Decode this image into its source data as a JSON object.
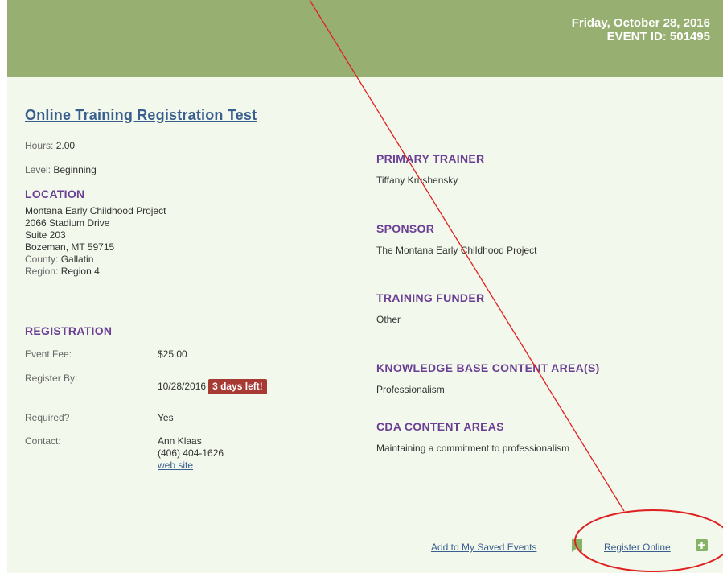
{
  "header": {
    "date": "Friday, October 28, 2016",
    "event_id": "EVENT ID: 501495"
  },
  "event": {
    "title": "Online Training Registration Test",
    "hours_label": "Hours:",
    "hours_value": "2.00",
    "level_label": "Level:",
    "level_value": "Beginning"
  },
  "location": {
    "heading": "LOCATION",
    "lines": [
      "Montana Early Childhood Project",
      "2066 Stadium Drive",
      "Suite 203",
      "Bozeman, MT 59715"
    ],
    "county_label": "County:",
    "county_value": "Gallatin",
    "region_label": "Region:",
    "region_value": "Region 4"
  },
  "registration": {
    "heading": "REGISTRATION",
    "fee_label": "Event Fee:",
    "fee_value": "$25.00",
    "register_by_label": "Register By:",
    "register_by_value": "10/28/2016",
    "days_left_badge": "3 days left!",
    "required_label": "Required?",
    "required_value": "Yes",
    "contact_label": "Contact:",
    "contact_name": "Ann Klaas",
    "contact_phone": "(406) 404-1626",
    "contact_link": "web site"
  },
  "details": {
    "primary_trainer_heading": "PRIMARY TRAINER",
    "primary_trainer_value": "Tiffany Krushensky",
    "sponsor_heading": "SPONSOR",
    "sponsor_value": "The Montana Early Childhood Project",
    "funder_heading": "TRAINING FUNDER",
    "funder_value": "Other",
    "kb_heading": "KNOWLEDGE BASE CONTENT AREA(S)",
    "kb_value": "Professionalism",
    "cda_heading": "CDA CONTENT AREAS",
    "cda_value": "Maintaining a commitment to professionalism"
  },
  "actions": {
    "save_label": "Add to My Saved Events",
    "register_label": "Register Online"
  },
  "colors": {
    "header_bg": "#97b071",
    "panel_bg": "#f2f8ec",
    "section_heading": "#6b3f94",
    "link": "#3a5f8f",
    "badge": "#a83a34",
    "annotation": "#e02020"
  },
  "icons": {
    "save": "bookmark-icon",
    "register": "plus-icon"
  }
}
